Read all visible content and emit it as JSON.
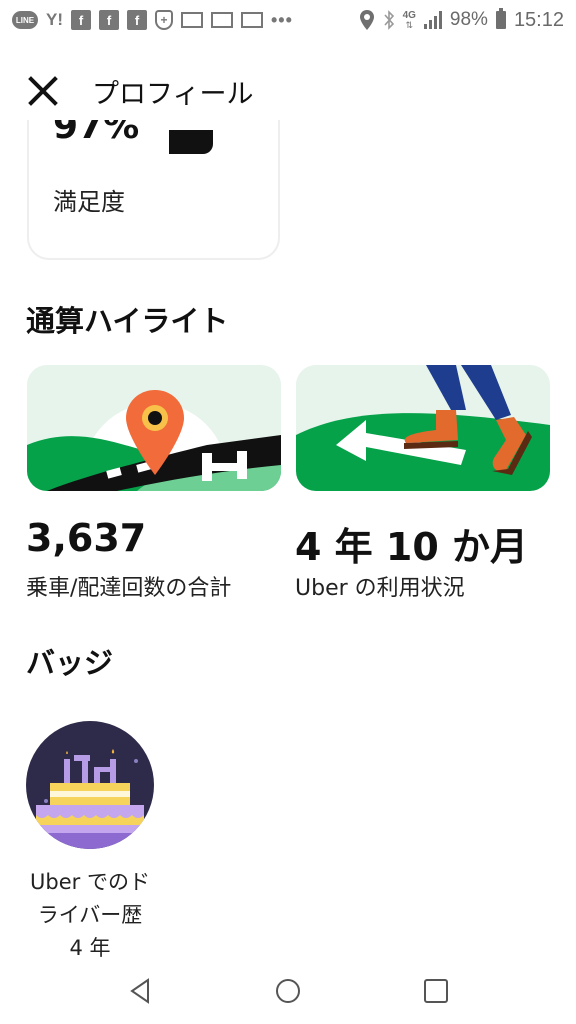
{
  "status_bar": {
    "time": "15:12",
    "battery_percent": "98%",
    "network": "4G",
    "notification_icons": [
      "line-icon",
      "yahoo-icon",
      "facebook-icon",
      "facebook-icon",
      "facebook-icon",
      "shield-icon",
      "mail-icon",
      "mail-icon",
      "mail-icon",
      "more-dots-icon"
    ],
    "line_text": "LINE",
    "yahoo_text": "Y!",
    "fb_text": "f",
    "dots": "•••"
  },
  "header": {
    "title": "プロフィール",
    "close_icon": "close-icon"
  },
  "rating": {
    "value": "97%",
    "label": "満足度"
  },
  "highlights": {
    "title": "通算ハイライト",
    "items": [
      {
        "value": "3,637",
        "label": "乗車/配達回数の合計"
      },
      {
        "value": "4 年 10 か月",
        "label": "Uber の利用状況"
      }
    ]
  },
  "badges": {
    "title": "バッジ",
    "items": [
      {
        "label": "Uber でのド\nライバー歴\n4 年"
      }
    ]
  },
  "nav": {
    "back_icon": "back-triangle-icon",
    "home_icon": "home-circle-icon",
    "recents_icon": "recents-square-icon"
  },
  "colors": {
    "green": "#06a24a",
    "light_green": "#e6f4ec",
    "orange_pin": "#f26b3a",
    "badge_bg": "#2e2a4a"
  }
}
